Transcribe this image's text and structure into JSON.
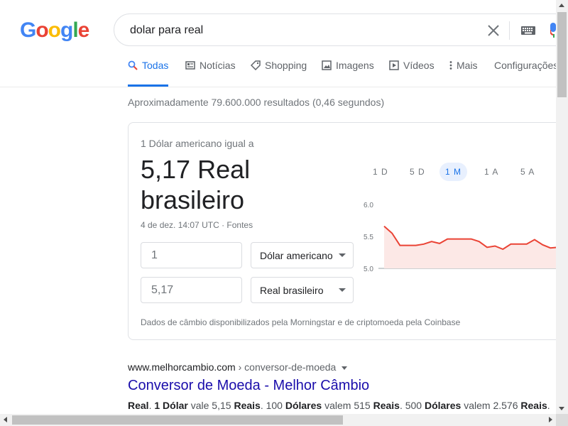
{
  "logo": {
    "text": "Google",
    "letters": [
      "G",
      "o",
      "o",
      "g",
      "l",
      "e"
    ]
  },
  "search": {
    "query": "dolar para real"
  },
  "tabs": [
    {
      "label": "Todas",
      "icon": "search-icon",
      "active": true
    },
    {
      "label": "Notícias",
      "icon": "news-icon",
      "active": false
    },
    {
      "label": "Shopping",
      "icon": "tag-icon",
      "active": false
    },
    {
      "label": "Imagens",
      "icon": "image-icon",
      "active": false
    },
    {
      "label": "Vídeos",
      "icon": "video-icon",
      "active": false
    },
    {
      "label": "Mais",
      "icon": "more-vert-icon",
      "active": false
    },
    {
      "label": "Configurações",
      "icon": "",
      "active": false
    }
  ],
  "result_stats": "Aproximadamente 79.600.000 resultados (0,46 segundos)",
  "converter": {
    "label": "1 Dólar americano igual a",
    "value": "5,17 Real brasileiro",
    "date": "4 de dez. 14:07 UTC",
    "separator": " · ",
    "sources": "Fontes",
    "from_amount": "1",
    "from_currency": "Dólar americano",
    "to_amount": "5,17",
    "to_currency": "Real brasileiro",
    "disclaimer": "Dados de câmbio disponibilizados pela Morningstar e de criptomoeda pela Coinbase",
    "ranges": [
      "1 D",
      "5 D",
      "1 M",
      "1 A",
      "5 A"
    ],
    "active_range": "1 M"
  },
  "chart_data": {
    "type": "area",
    "y_ticks": [
      "6.0",
      "5.5",
      "5.0"
    ],
    "ylim": [
      5.0,
      6.0
    ],
    "baseline": 5.0,
    "values": [
      5.66,
      5.55,
      5.36,
      5.36,
      5.36,
      5.38,
      5.42,
      5.39,
      5.46,
      5.46,
      5.46,
      5.46,
      5.42,
      5.33,
      5.35,
      5.3,
      5.38,
      5.38,
      5.38,
      5.45,
      5.37,
      5.32,
      5.33,
      5.34,
      5.34,
      5.34,
      5.32
    ],
    "line_color": "#ea4335",
    "fill_color": "#fce8e6"
  },
  "result": {
    "domain": "www.melhorcambio.com",
    "path": " › conversor-de-moeda",
    "title": "Conversor de Moeda - Melhor Câmbio",
    "snippet": [
      {
        "t": "Real",
        "b": true
      },
      {
        "t": ". ",
        "b": false
      },
      {
        "t": "1",
        "b": true
      },
      {
        "t": " ",
        "b": false
      },
      {
        "t": "Dólar",
        "b": true
      },
      {
        "t": " vale 5,15 ",
        "b": false
      },
      {
        "t": "Reais",
        "b": true
      },
      {
        "t": ". 100 ",
        "b": false
      },
      {
        "t": "Dólares",
        "b": true
      },
      {
        "t": " valem 515 ",
        "b": false
      },
      {
        "t": "Reais",
        "b": true
      },
      {
        "t": ". 500 ",
        "b": false
      },
      {
        "t": "Dólares",
        "b": true
      },
      {
        "t": " valem 2.576 ",
        "b": false
      },
      {
        "t": "Reais",
        "b": true
      },
      {
        "t": ".",
        "b": false
      }
    ]
  },
  "colors": {
    "accent": "#1a73e8",
    "link": "#1a0dab",
    "logo": [
      "#4285f4",
      "#ea4335",
      "#fbbc05",
      "#4285f4",
      "#34a853",
      "#ea4335"
    ]
  }
}
